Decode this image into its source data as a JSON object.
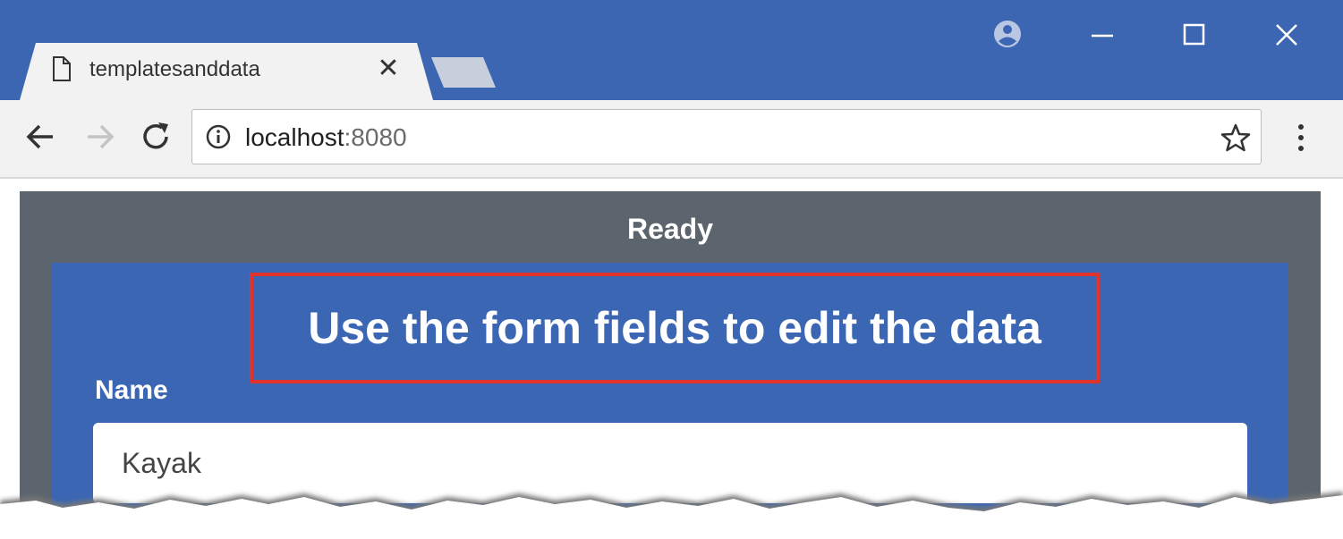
{
  "browser": {
    "tab": {
      "title": "templatesanddata",
      "close_glyph": "✕"
    },
    "address": {
      "host": "localhost",
      "port": ":8080"
    },
    "icons": {
      "tab": "document-icon",
      "profile": "profile-icon",
      "minimize": "minimize-icon",
      "maximize": "maximize-icon",
      "close": "close-icon",
      "back": "back-arrow-icon",
      "forward": "forward-arrow-icon",
      "reload": "reload-icon",
      "info": "info-icon",
      "bookmark": "star-icon",
      "menu": "kebab-menu-icon"
    }
  },
  "page": {
    "status": "Ready",
    "heading": "Use the form fields to edit the data",
    "form": {
      "name_label": "Name",
      "name_value": "Kayak"
    }
  },
  "colors": {
    "titlebar": "#3d66b2",
    "outer_panel": "#5c656e",
    "inner_panel": "#3a66b3",
    "highlight_border": "#e0332c"
  }
}
